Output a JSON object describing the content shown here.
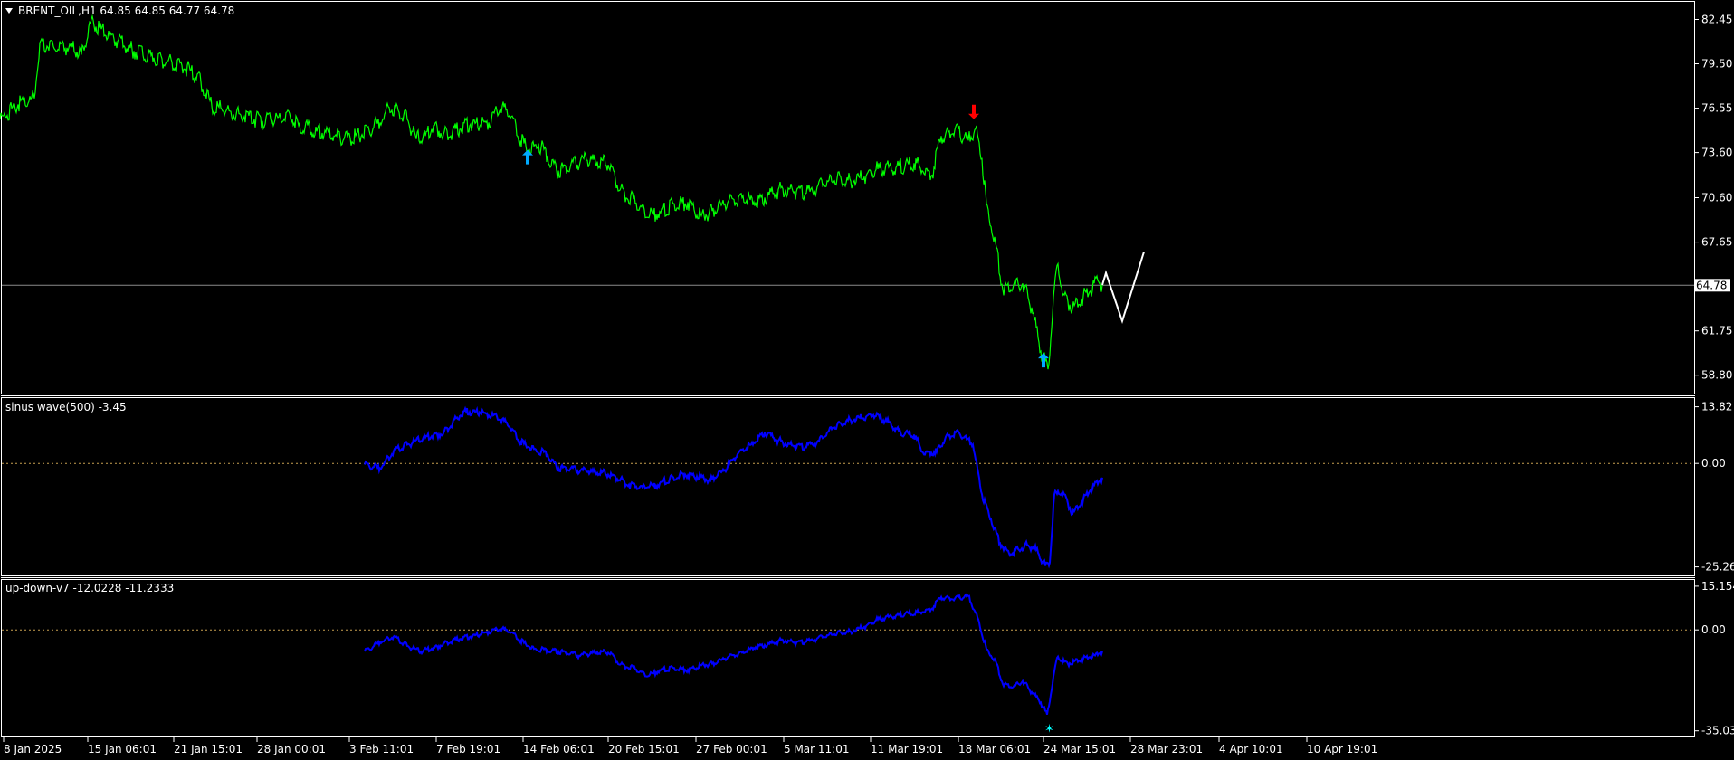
{
  "colors": {
    "background": "#000000",
    "frame": "#ffffff",
    "price_line": "#00ff00",
    "projection": "#ffffff",
    "indicator_line": "#0000ff",
    "zero_line": "#c8a050",
    "arrow_up": "#00aaff",
    "arrow_down": "#ff0000",
    "signal_star": "#00ffff",
    "current_price_box": "#ffffff"
  },
  "main_panel": {
    "header_icon": "triangle-down-icon",
    "header": "BRENT_OIL,H1  64.85 64.85 64.77 64.78",
    "current_price": "64.78",
    "y_ticks": [
      "82.45",
      "79.50",
      "76.55",
      "73.60",
      "70.60",
      "67.65",
      "61.75",
      "58.80"
    ]
  },
  "sub_panel_1": {
    "header": "sinus wave(500) -3.45",
    "y_ticks": [
      "13.82",
      "0.00",
      "-25.26"
    ]
  },
  "sub_panel_2": {
    "header": "up-down-v7 -12.0228 -11.2333",
    "y_ticks": [
      "15.1542",
      "0.00",
      "-35.0365"
    ]
  },
  "x_axis": {
    "labels": [
      "8 Jan 2025",
      "15 Jan 06:01",
      "21 Jan 15:01",
      "28 Jan 00:01",
      "3 Feb 11:01",
      "7 Feb 19:01",
      "14 Feb 06:01",
      "20 Feb 15:01",
      "27 Feb 00:01",
      "5 Mar 11:01",
      "11 Mar 19:01",
      "18 Mar 06:01",
      "24 Mar 15:01",
      "28 Mar 23:01",
      "4 Apr 10:01",
      "10 Apr 19:01"
    ]
  },
  "chart_data": [
    {
      "type": "line",
      "title": "BRENT_OIL,H1",
      "series": [
        {
          "name": "BRENT_OIL,H1",
          "points": [
            [
              0,
              75.8
            ],
            [
              20,
              76.8
            ],
            [
              38,
              77.2
            ],
            [
              44,
              80.9
            ],
            [
              60,
              80.5
            ],
            [
              80,
              80.6
            ],
            [
              90,
              80.1
            ],
            [
              100,
              82.2
            ],
            [
              110,
              81.9
            ],
            [
              130,
              81.0
            ],
            [
              150,
              80.3
            ],
            [
              170,
              79.9
            ],
            [
              190,
              79.6
            ],
            [
              210,
              79.1
            ],
            [
              222,
              78.3
            ],
            [
              234,
              76.7
            ],
            [
              250,
              76.4
            ],
            [
              270,
              76.0
            ],
            [
              290,
              75.7
            ],
            [
              310,
              75.9
            ],
            [
              320,
              76.2
            ],
            [
              330,
              75.4
            ],
            [
              350,
              75.0
            ],
            [
              370,
              74.7
            ],
            [
              380,
              74.5
            ],
            [
              400,
              74.8
            ],
            [
              420,
              75.6
            ],
            [
              430,
              76.6
            ],
            [
              440,
              76.4
            ],
            [
              450,
              75.8
            ],
            [
              460,
              74.5
            ],
            [
              470,
              74.7
            ],
            [
              480,
              75.4
            ],
            [
              490,
              74.8
            ],
            [
              500,
              75.0
            ],
            [
              520,
              75.5
            ],
            [
              540,
              75.6
            ],
            [
              555,
              76.7
            ],
            [
              565,
              76.0
            ],
            [
              575,
              74.4
            ],
            [
              585,
              73.8
            ],
            [
              595,
              74.2
            ],
            [
              605,
              73.4
            ],
            [
              615,
              72.4
            ],
            [
              630,
              72.6
            ],
            [
              645,
              73.2
            ],
            [
              660,
              73.0
            ],
            [
              675,
              72.8
            ],
            [
              685,
              71.1
            ],
            [
              700,
              70.5
            ],
            [
              715,
              69.3
            ],
            [
              730,
              69.6
            ],
            [
              745,
              70.2
            ],
            [
              760,
              70.3
            ],
            [
              775,
              69.4
            ],
            [
              790,
              69.7
            ],
            [
              805,
              70.4
            ],
            [
              820,
              70.6
            ],
            [
              835,
              70.3
            ],
            [
              850,
              70.8
            ],
            [
              865,
              71.2
            ],
            [
              880,
              71.0
            ],
            [
              895,
              71.0
            ],
            [
              910,
              71.5
            ],
            [
              925,
              71.9
            ],
            [
              940,
              71.7
            ],
            [
              955,
              72.0
            ],
            [
              970,
              72.5
            ],
            [
              990,
              72.6
            ],
            [
              1010,
              72.9
            ],
            [
              1030,
              72.1
            ],
            [
              1040,
              74.7
            ],
            [
              1055,
              75.1
            ],
            [
              1070,
              74.4
            ],
            [
              1078,
              75.2
            ],
            [
              1085,
              73.2
            ],
            [
              1090,
              70.2
            ],
            [
              1100,
              67.6
            ],
            [
              1108,
              64.5
            ],
            [
              1120,
              64.8
            ],
            [
              1130,
              64.9
            ],
            [
              1140,
              63.3
            ],
            [
              1150,
              60.4
            ],
            [
              1158,
              59.2
            ],
            [
              1163,
              62.8
            ],
            [
              1168,
              66.1
            ],
            [
              1175,
              64.2
            ],
            [
              1185,
              63.2
            ],
            [
              1195,
              63.9
            ],
            [
              1205,
              64.4
            ],
            [
              1213,
              65.1
            ],
            [
              1218,
              64.8
            ]
          ]
        },
        {
          "name": "projection",
          "points": [
            [
              1218,
              64.8
            ],
            [
              1222,
              65.6
            ],
            [
              1240,
              62.4
            ],
            [
              1264,
              67.0
            ]
          ]
        }
      ],
      "annotations": [
        {
          "type": "arrow-up",
          "x": 583,
          "y": 73.3,
          "color": "#00aaff"
        },
        {
          "type": "arrow-down",
          "x": 1076,
          "y": 76.3,
          "color": "#ff0000"
        },
        {
          "type": "arrow-up",
          "x": 1153,
          "y": 59.8,
          "color": "#00aaff"
        }
      ],
      "ylim": [
        57.7,
        83.5
      ],
      "current_price": 64.78,
      "grid": false
    },
    {
      "type": "line",
      "title": "sinus wave(500) -3.45",
      "series": [
        {
          "name": "sinus wave(500)",
          "points": [
            [
              403,
              -0.3
            ],
            [
              420,
              -1.2
            ],
            [
              435,
              3.0
            ],
            [
              450,
              4.6
            ],
            [
              470,
              6.3
            ],
            [
              490,
              7.4
            ],
            [
              505,
              11.2
            ],
            [
              515,
              12.7
            ],
            [
              530,
              12.5
            ],
            [
              545,
              11.7
            ],
            [
              560,
              10.0
            ],
            [
              575,
              5.2
            ],
            [
              590,
              3.5
            ],
            [
              605,
              2.3
            ],
            [
              615,
              -1.0
            ],
            [
              630,
              -1.4
            ],
            [
              650,
              -2.0
            ],
            [
              665,
              -2.2
            ],
            [
              680,
              -3.2
            ],
            [
              695,
              -5.2
            ],
            [
              710,
              -5.9
            ],
            [
              725,
              -5.5
            ],
            [
              740,
              -3.8
            ],
            [
              755,
              -2.5
            ],
            [
              770,
              -3.2
            ],
            [
              785,
              -4.1
            ],
            [
              800,
              -1.8
            ],
            [
              815,
              2.3
            ],
            [
              830,
              4.6
            ],
            [
              845,
              7.6
            ],
            [
              860,
              5.6
            ],
            [
              875,
              4.4
            ],
            [
              890,
              4.0
            ],
            [
              905,
              5.4
            ],
            [
              920,
              8.7
            ],
            [
              935,
              10.3
            ],
            [
              950,
              11.1
            ],
            [
              965,
              11.8
            ],
            [
              980,
              10.3
            ],
            [
              995,
              7.6
            ],
            [
              1010,
              7.0
            ],
            [
              1020,
              2.6
            ],
            [
              1035,
              2.8
            ],
            [
              1045,
              6.5
            ],
            [
              1060,
              7.4
            ],
            [
              1075,
              4.6
            ],
            [
              1085,
              -7.5
            ],
            [
              1095,
              -13.6
            ],
            [
              1105,
              -19.5
            ],
            [
              1115,
              -22.0
            ],
            [
              1125,
              -20.9
            ],
            [
              1135,
              -19.9
            ],
            [
              1145,
              -21.1
            ],
            [
              1155,
              -25.0
            ],
            [
              1160,
              -24.2
            ],
            [
              1165,
              -7.6
            ],
            [
              1175,
              -7.1
            ],
            [
              1185,
              -12.4
            ],
            [
              1195,
              -9.4
            ],
            [
              1205,
              -6.5
            ],
            [
              1218,
              -3.45
            ]
          ]
        }
      ],
      "ylim": [
        -26.9,
        15.5
      ],
      "zero_line": 0,
      "grid": false
    },
    {
      "type": "line",
      "title": "up-down-v7 -12.0228 -11.2333",
      "series": [
        {
          "name": "up-down-v7",
          "points": [
            [
              403,
              -7.5
            ],
            [
              420,
              -4.3
            ],
            [
              435,
              -2.3
            ],
            [
              450,
              -5.6
            ],
            [
              465,
              -7.6
            ],
            [
              480,
              -6.2
            ],
            [
              500,
              -3.7
            ],
            [
              520,
              -2.3
            ],
            [
              540,
              -0.7
            ],
            [
              555,
              0.5
            ],
            [
              565,
              -0.9
            ],
            [
              575,
              -3.8
            ],
            [
              590,
              -6.6
            ],
            [
              610,
              -7.1
            ],
            [
              625,
              -7.9
            ],
            [
              640,
              -9.0
            ],
            [
              660,
              -7.7
            ],
            [
              675,
              -7.9
            ],
            [
              685,
              -12.1
            ],
            [
              700,
              -13.1
            ],
            [
              715,
              -16.2
            ],
            [
              730,
              -14.0
            ],
            [
              745,
              -13.2
            ],
            [
              760,
              -13.9
            ],
            [
              775,
              -12.3
            ],
            [
              790,
              -11.7
            ],
            [
              805,
              -9.3
            ],
            [
              820,
              -7.9
            ],
            [
              835,
              -6.0
            ],
            [
              850,
              -4.9
            ],
            [
              865,
              -3.5
            ],
            [
              880,
              -4.5
            ],
            [
              895,
              -3.8
            ],
            [
              910,
              -2.4
            ],
            [
              925,
              -1.1
            ],
            [
              940,
              -0.6
            ],
            [
              955,
              1.0
            ],
            [
              970,
              3.6
            ],
            [
              985,
              4.6
            ],
            [
              1000,
              5.6
            ],
            [
              1015,
              6.0
            ],
            [
              1030,
              7.4
            ],
            [
              1040,
              11.4
            ],
            [
              1055,
              10.8
            ],
            [
              1070,
              11.7
            ],
            [
              1080,
              4.4
            ],
            [
              1090,
              -6.6
            ],
            [
              1100,
              -10.7
            ],
            [
              1108,
              -18.8
            ],
            [
              1120,
              -19.7
            ],
            [
              1130,
              -17.8
            ],
            [
              1140,
              -21.6
            ],
            [
              1150,
              -25.2
            ],
            [
              1157,
              -29.4
            ],
            [
              1163,
              -18.8
            ],
            [
              1168,
              -9.7
            ],
            [
              1180,
              -11.8
            ],
            [
              1195,
              -10.2
            ],
            [
              1210,
              -8.9
            ],
            [
              1218,
              -7.5
            ]
          ]
        }
      ],
      "annotations": [
        {
          "type": "star",
          "x": 1159,
          "y": -34.0,
          "color": "#00ffff"
        }
      ],
      "ylim": [
        -36.4,
        16.7
      ],
      "zero_line": 0,
      "grid": false
    }
  ]
}
